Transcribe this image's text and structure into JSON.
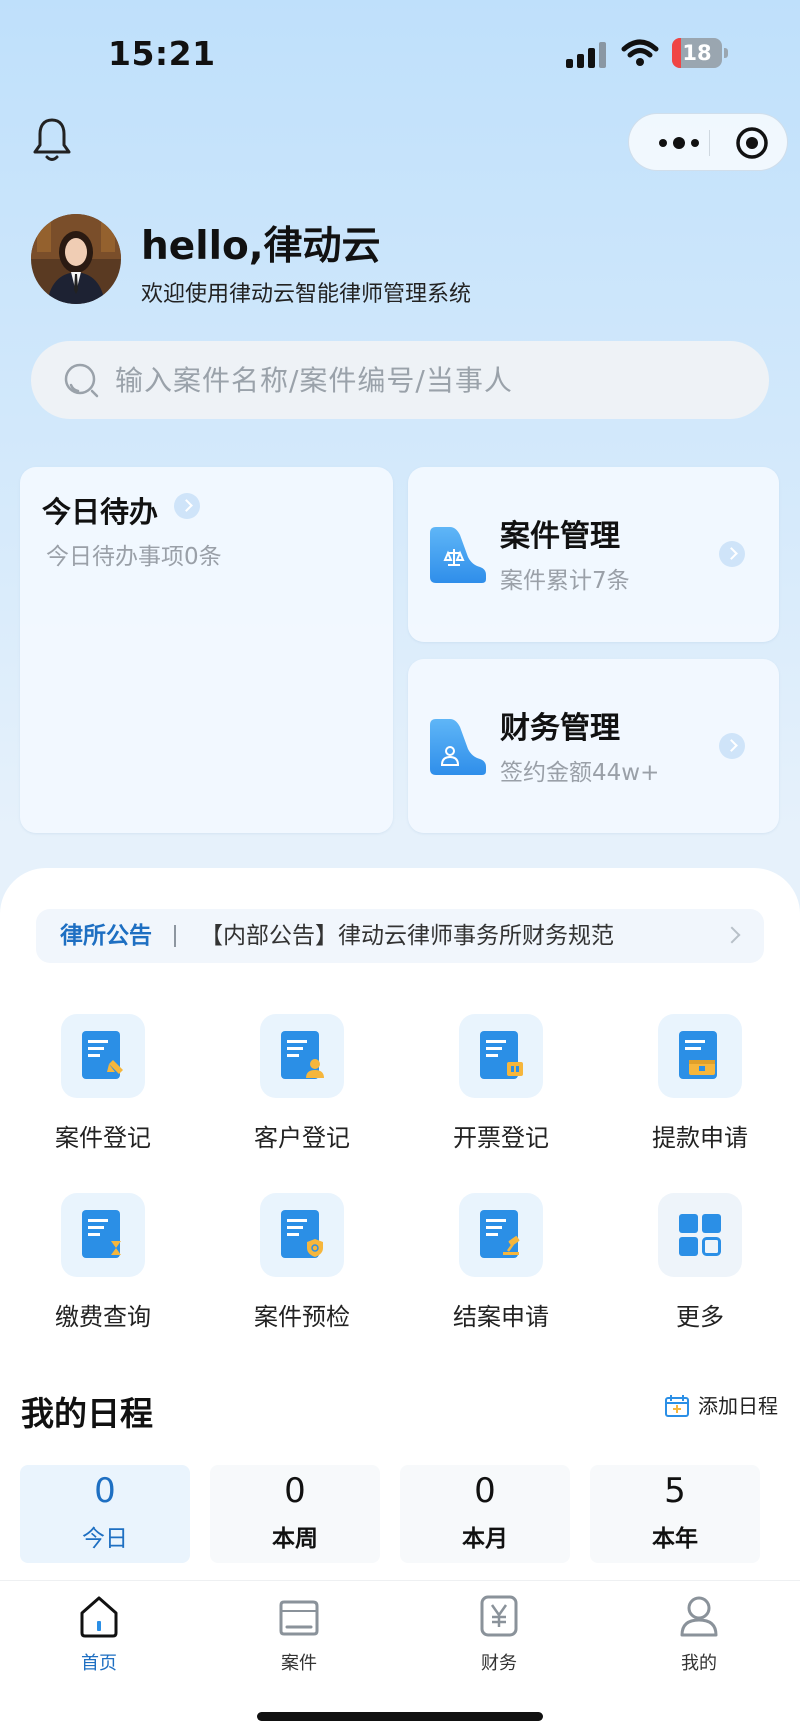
{
  "status_bar": {
    "time": "15:21",
    "battery": "18",
    "battery_percent": 18
  },
  "profile": {
    "greeting": "hello,律动云",
    "welcome": "欢迎使用律动云智能律师管理系统"
  },
  "search": {
    "placeholder": "输入案件名称/案件编号/当事人"
  },
  "cards": {
    "todo": {
      "title": "今日待办",
      "sub": "今日待办事项0条"
    },
    "case_mgmt": {
      "title": "案件管理",
      "sub": "案件累计7条"
    },
    "finance_mgmt": {
      "title": "财务管理",
      "sub": "签约金额44w+"
    }
  },
  "notice": {
    "tag": "律所公告",
    "text": "【内部公告】律动云律师事务所财务规范"
  },
  "grid": [
    {
      "label": "案件登记",
      "icon": "doc-pen-icon"
    },
    {
      "label": "客户登记",
      "icon": "doc-person-icon"
    },
    {
      "label": "开票登记",
      "icon": "doc-invoice-icon"
    },
    {
      "label": "提款申请",
      "icon": "doc-wallet-icon"
    },
    {
      "label": "缴费查询",
      "icon": "doc-hourglass-icon"
    },
    {
      "label": "案件预检",
      "icon": "doc-shield-icon"
    },
    {
      "label": "结案申请",
      "icon": "doc-gavel-icon"
    },
    {
      "label": "更多",
      "icon": "more-grid-icon"
    }
  ],
  "schedule": {
    "title": "我的日程",
    "add_label": "添加日程",
    "stats": [
      {
        "num": "0",
        "label": "今日"
      },
      {
        "num": "0",
        "label": "本周"
      },
      {
        "num": "0",
        "label": "本月"
      },
      {
        "num": "5",
        "label": "本年"
      }
    ]
  },
  "tabs": [
    {
      "label": "首页",
      "icon": "home-icon"
    },
    {
      "label": "案件",
      "icon": "folder-icon"
    },
    {
      "label": "财务",
      "icon": "yen-icon"
    },
    {
      "label": "我的",
      "icon": "user-icon"
    }
  ],
  "colors": {
    "accent": "#1e6fc2",
    "icon_blue": "#2b8fe6",
    "battery_low": "#f04545"
  }
}
